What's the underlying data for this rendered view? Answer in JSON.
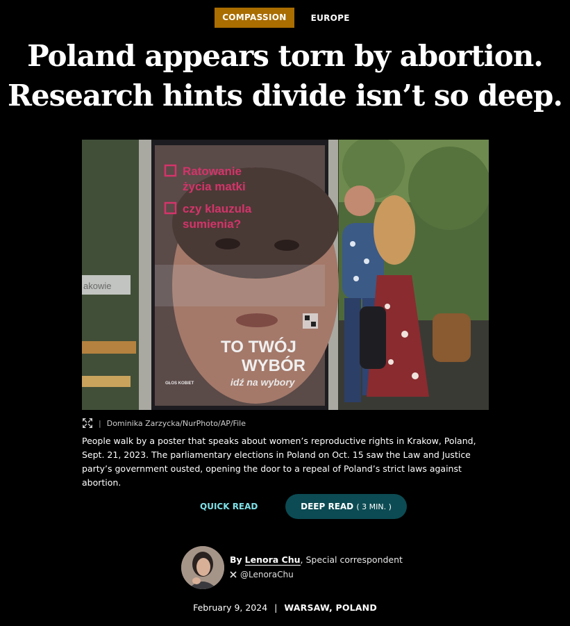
{
  "tags": {
    "primary": "COMPASSION",
    "secondary": "EUROPE"
  },
  "headline": {
    "line1": "Poland appears torn by abortion.",
    "line2": "Research hints divide isn’t so deep."
  },
  "photo": {
    "poster_line1": "Ratowanie",
    "poster_line2": "życia matki",
    "poster_line3": "czy klauzula",
    "poster_line4": "sumienia?",
    "poster_big1": "TO TWÓJ",
    "poster_big2": "WYBÓR",
    "poster_sub": "idź na wybory",
    "poster_logo": "GŁOS KOBIET",
    "stop_sign": "akowie"
  },
  "credit": {
    "separator": "|",
    "text": "Dominika Zarzycka/NurPhoto/AP/File"
  },
  "caption": "People walk by a poster that speaks about women’s reproductive rights in Krakow, Poland, Sept. 21, 2023. The parliamentary elections in Poland on Oct. 15 saw the Law and Justice party’s government ousted, opening the door to a repeal of Poland’s strict laws against abortion.",
  "read_toggle": {
    "quick": "QUICK READ",
    "deep": "DEEP READ",
    "deep_minutes": "( 3 MIN. )"
  },
  "byline": {
    "by": "By",
    "author": "Lenora Chu",
    "role": ", Special correspondent",
    "twitter": "@LenoraChu"
  },
  "dateline": {
    "date": "February 9, 2024",
    "separator": "|",
    "location": "WARSAW, POLAND"
  },
  "colors": {
    "tag_bg": "#a96d00",
    "quick_read": "#7fe0e6",
    "deep_read_bg": "#0c4b53",
    "poster_pink": "#d4346a"
  }
}
